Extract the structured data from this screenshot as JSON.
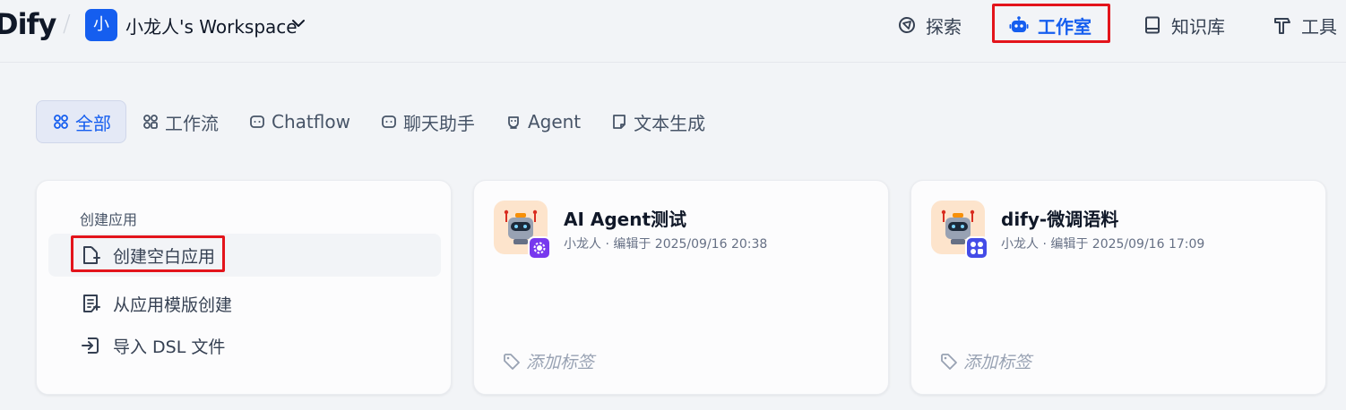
{
  "header": {
    "logo_text": "Dify",
    "workspace": {
      "avatar": "小",
      "name": "小龙人's Workspace"
    },
    "nav": [
      {
        "label": "探索",
        "icon": "compass-icon"
      },
      {
        "label": "工作室",
        "icon": "robot-icon",
        "active": true
      },
      {
        "label": "知识库",
        "icon": "book-icon"
      },
      {
        "label": "工具",
        "icon": "hammer-icon"
      }
    ]
  },
  "tabs": [
    {
      "label": "全部",
      "icon": "grid-icon",
      "active": true
    },
    {
      "label": "工作流",
      "icon": "workflow-icon"
    },
    {
      "label": "Chatflow",
      "icon": "chat-bubble-icon"
    },
    {
      "label": "聊天助手",
      "icon": "chat-bubble-icon"
    },
    {
      "label": "Agent",
      "icon": "agent-icon"
    },
    {
      "label": "文本生成",
      "icon": "document-icon"
    }
  ],
  "create": {
    "title": "创建应用",
    "items": [
      {
        "label": "创建空白应用",
        "icon": "file-plus-icon"
      },
      {
        "label": "从应用模版创建",
        "icon": "template-icon"
      },
      {
        "label": "导入 DSL 文件",
        "icon": "import-icon"
      }
    ]
  },
  "apps": [
    {
      "name": "AI Agent测试",
      "meta": "小龙人 · 编辑于 2025/09/16 20:38",
      "tag": "添加标签",
      "badge_color": "#7839ee",
      "badge_icon": "gear-icon"
    },
    {
      "name": "dify-微调语料",
      "meta": "小龙人 · 编辑于 2025/09/16 17:09",
      "tag": "添加标签",
      "badge_color": "#444ce7",
      "badge_icon": "workflow-icon"
    }
  ],
  "colors": {
    "accent": "#155eef",
    "highlight": "#e3141b"
  }
}
